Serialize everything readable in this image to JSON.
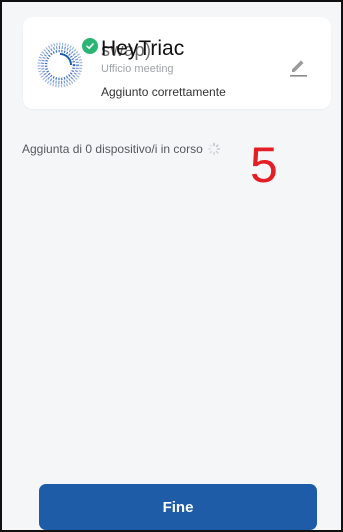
{
  "device": {
    "name_overlay": "HeyTriac",
    "name_underlay": "swap)",
    "room": "Ufficio meeting",
    "status": "Aggiunto correttamente",
    "icon": "device-ring-icon",
    "badge_icon": "check-circle-icon",
    "edit_icon": "pencil-icon"
  },
  "progress": {
    "text": "Aggiunta di 0 dispositivo/i in corso",
    "spinner_icon": "spinner-icon"
  },
  "countdown": "5",
  "footer": {
    "done_label": "Fine"
  },
  "colors": {
    "accent": "#1f5ca7",
    "success": "#2ab573",
    "countdown": "#e31e24",
    "background": "#f5f6f8"
  }
}
